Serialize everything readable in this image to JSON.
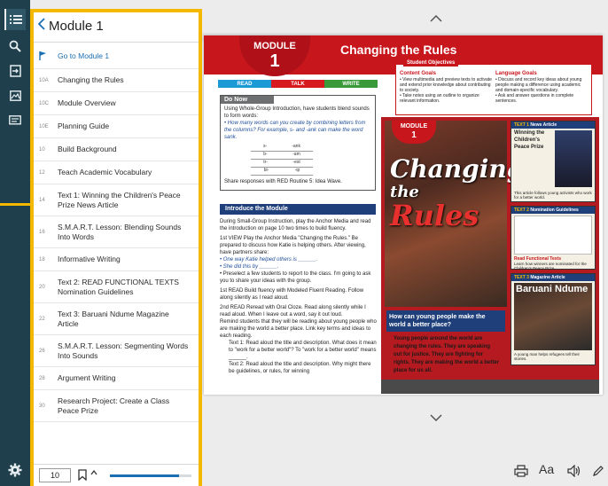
{
  "panel": {
    "title": "Module 1",
    "items": [
      {
        "num": "",
        "label": "Go to Module 1",
        "active": true
      },
      {
        "num": "10A",
        "label": "Changing the Rules"
      },
      {
        "num": "10C",
        "label": "Module Overview"
      },
      {
        "num": "10E",
        "label": "Planning Guide"
      },
      {
        "num": "10",
        "label": "Build Background"
      },
      {
        "num": "12",
        "label": "Teach Academic Vocabulary"
      },
      {
        "num": "14",
        "label": "Text 1: Winning the Children's Peace Prize News Article"
      },
      {
        "num": "16",
        "label": "S.M.A.R.T. Lesson: Blending Sounds Into Words"
      },
      {
        "num": "18",
        "label": "Informative Writing"
      },
      {
        "num": "20",
        "label": "Text 2: READ FUNCTIONAL TEXTS Nomination Guidelines"
      },
      {
        "num": "22",
        "label": "Text 3: Baruani Ndume Magazine Article"
      },
      {
        "num": "26",
        "label": "S.M.A.R.T. Lesson: Segmenting Words Into Sounds"
      },
      {
        "num": "28",
        "label": "Argument Writing"
      },
      {
        "num": "30",
        "label": "Research Project: Create a Class Peace Prize"
      }
    ],
    "footer": {
      "page": "10",
      "progress": 0.85
    }
  },
  "book": {
    "module_word": "MODULE",
    "module_number": "1",
    "module_title": "Changing the Rules",
    "srw": [
      "READ",
      "TALK",
      "WRITE"
    ],
    "do_now": {
      "heading": "Do Now",
      "intro": "Using Whole-Group Introduction, have students blend sounds to form words:",
      "question": "• How many words can you create by combining letters from the columns? For example, s- and -ank can make the word sank.",
      "left_col": [
        "s-",
        "b-",
        "tr-",
        "bl-"
      ],
      "right_col": [
        "-ank",
        "-am",
        "-est",
        "-ip"
      ],
      "share": "Share responses with RED Routine 5: Idea Wave."
    },
    "intro_heading": "Introduce the Module",
    "intro_text": "During Small-Group Instruction, play the Anchor Media and read the introduction on page 10 two times to build fluency.",
    "first_view": "1st VIEW Play the Anchor Media \"Changing the Rules.\" Be prepared to discuss how Katie is helping others. After viewing, have partners share:",
    "bullets": [
      "• One way Katie helped others is ______.",
      "• She did this by ______.",
      "• Preselect a few students to report to the class. I'm going to ask you to share your ideas with the group."
    ],
    "first_read": "1st READ Build fluency with Modeled Fluent Reading. Follow along silently as I read aloud.",
    "second_read": "2nd READ Reread with Oral Cloze. Read along silently while I read aloud. When I leave out a word, say it out loud.",
    "remind": "Remind students that they will be reading about young people who are making the world a better place. Link key terms and ideas to each reading.",
    "text1": "Text 1: Read aloud the title and description. What does it mean to \"work for a better world\"? To \"work for a better world\" means ______.",
    "text2": "Text 2: Read aloud the title and description. Why might there be guidelines, or rules, for winning",
    "objectives": {
      "heading": "Student Objectives",
      "content_goals": "Content Goals",
      "content_items": [
        "• View multimedia and preview texts to activate and extend prior knowledge about contributing to society.",
        "• Take notes using an outline to organize relevant information."
      ],
      "language_goals": "Language Goals",
      "language_items": [
        "• Discuss and record key ideas about young people making a difference using academic and domain-specific vocabulary.",
        "• Ask and answer questions in complete sentences."
      ]
    },
    "cover": {
      "module_word": "MODULE",
      "module_number": "1",
      "title_line1": "Changing",
      "title_line2": "the",
      "title_line3": "Rules",
      "question": "How can young people make the world a better place?",
      "answer": "Young people around the world are changing the rules. They are speaking out for justice. They are fighting for rights. They are making the world a better place for us all.",
      "cards": [
        {
          "head": "TEXT 1",
          "type": "News Article",
          "title": "Winning the Children's Peace Prize",
          "desc": "This article follows young activists who work for a better world."
        },
        {
          "head": "TEXT 2",
          "type": "Nomination Guidelines",
          "title": "Read Functional Texts",
          "desc": "Learn how winners are nominated for the Children's Peace Prize."
        },
        {
          "head": "TEXT 3",
          "type": "Magazine Article",
          "title": "Baruani Ndume",
          "desc": "A young man helps refugees tell their stories."
        }
      ]
    }
  },
  "toolbar": {
    "aa": "Aa"
  }
}
